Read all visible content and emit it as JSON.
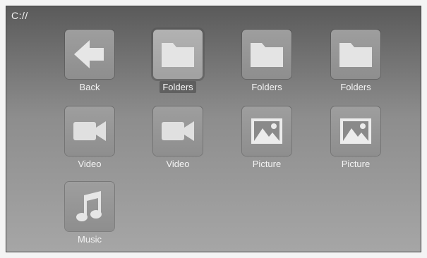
{
  "path": "C://",
  "items": [
    {
      "label": "Back",
      "icon": "back-arrow-icon"
    },
    {
      "label": "Folders",
      "icon": "folder-icon",
      "selected": true
    },
    {
      "label": "Folders",
      "icon": "folder-icon"
    },
    {
      "label": "Folders",
      "icon": "folder-icon"
    },
    {
      "label": "Video",
      "icon": "video-camera-icon"
    },
    {
      "label": "Video",
      "icon": "video-camera-icon"
    },
    {
      "label": "Picture",
      "icon": "picture-icon"
    },
    {
      "label": "Picture",
      "icon": "picture-icon"
    },
    {
      "label": "Music",
      "icon": "music-note-icon"
    }
  ]
}
